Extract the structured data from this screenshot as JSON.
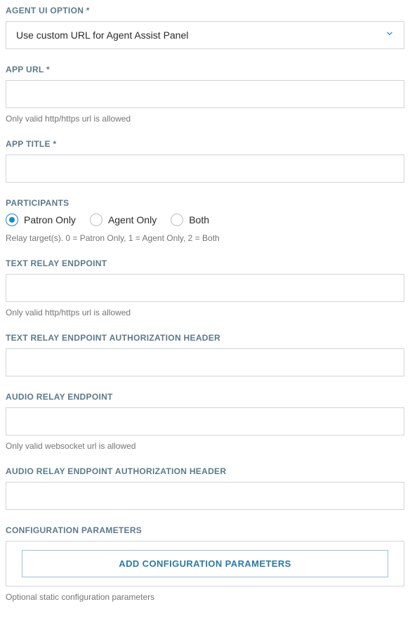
{
  "fields": {
    "agent_ui_option": {
      "label": "AGENT UI OPTION *",
      "value": "Use custom URL for Agent Assist Panel"
    },
    "app_url": {
      "label": "APP URL *",
      "value": "",
      "helper": "Only valid http/https url is allowed"
    },
    "app_title": {
      "label": "APP TITLE *",
      "value": ""
    },
    "participants": {
      "label": "PARTICIPANTS",
      "options": [
        {
          "label": "Patron Only",
          "selected": true
        },
        {
          "label": "Agent Only",
          "selected": false
        },
        {
          "label": "Both",
          "selected": false
        }
      ],
      "helper": "Relay target(s). 0 = Patron Only, 1 = Agent Only, 2 = Both"
    },
    "text_relay_endpoint": {
      "label": "TEXT RELAY ENDPOINT",
      "value": "",
      "helper": "Only valid http/https url is allowed"
    },
    "text_relay_auth": {
      "label": "TEXT RELAY ENDPOINT AUTHORIZATION HEADER",
      "value": ""
    },
    "audio_relay_endpoint": {
      "label": "AUDIO RELAY ENDPOINT",
      "value": "",
      "helper": "Only valid websocket url is allowed"
    },
    "audio_relay_auth": {
      "label": "AUDIO RELAY ENDPOINT AUTHORIZATION HEADER",
      "value": ""
    },
    "config_params": {
      "label": "CONFIGURATION PARAMETERS",
      "button": "ADD CONFIGURATION PARAMETERS",
      "helper": "Optional static configuration parameters"
    }
  }
}
